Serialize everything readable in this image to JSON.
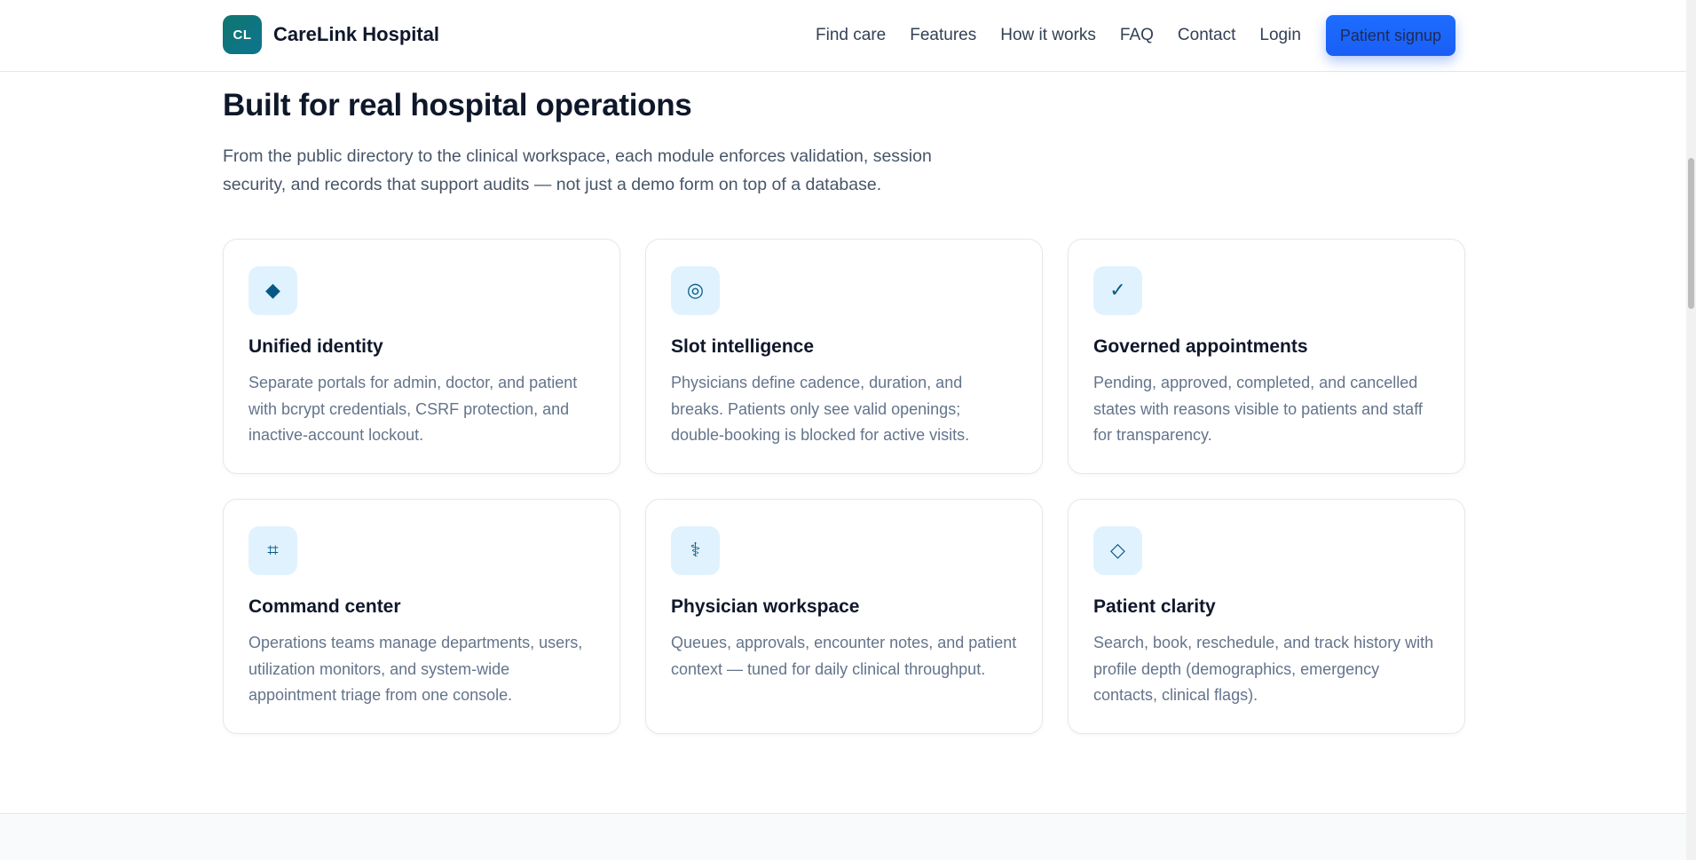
{
  "header": {
    "logo_text": "CL",
    "brand_name": "CareLink Hospital",
    "nav": [
      "Find care",
      "Features",
      "How it works",
      "FAQ",
      "Contact",
      "Login"
    ],
    "signup_label": "Patient signup"
  },
  "section": {
    "title": "Built for real hospital operations",
    "lead": "From the public directory to the clinical workspace, each module enforces validation, session security, and records that support audits — not just a demo form on top of a database."
  },
  "cards": [
    {
      "icon": "diamond-icon",
      "glyph": "◆",
      "title": "Unified identity",
      "text": "Separate portals for admin, doctor, and patient with bcrypt credentials, CSRF protection, and inactive-account lockout."
    },
    {
      "icon": "target-icon",
      "glyph": "◎",
      "title": "Slot intelligence",
      "text": "Physicians define cadence, duration, and breaks. Patients only see valid openings; double-booking is blocked for active visits."
    },
    {
      "icon": "check-icon",
      "glyph": "✓",
      "title": "Governed appointments",
      "text": "Pending, approved, completed, and cancelled states with reasons visible to patients and staff for transparency."
    },
    {
      "icon": "grid-hash-icon",
      "glyph": "⌗",
      "title": "Command center",
      "text": "Operations teams manage departments, users, utilization monitors, and system-wide appointment triage from one console."
    },
    {
      "icon": "caduceus-icon",
      "glyph": "⚕",
      "title": "Physician workspace",
      "text": "Queues, approvals, encounter notes, and patient context — tuned for daily clinical throughput."
    },
    {
      "icon": "diamond-outline-icon",
      "glyph": "◇",
      "title": "Patient clarity",
      "text": "Search, book, reschedule, and track history with profile depth (demographics, emergency contacts, clinical flags)."
    }
  ],
  "colors": {
    "accent": "#1d6dff",
    "logo": "#0f766e",
    "icon_bg": "#e0f2fe",
    "icon_fg": "#075985"
  }
}
